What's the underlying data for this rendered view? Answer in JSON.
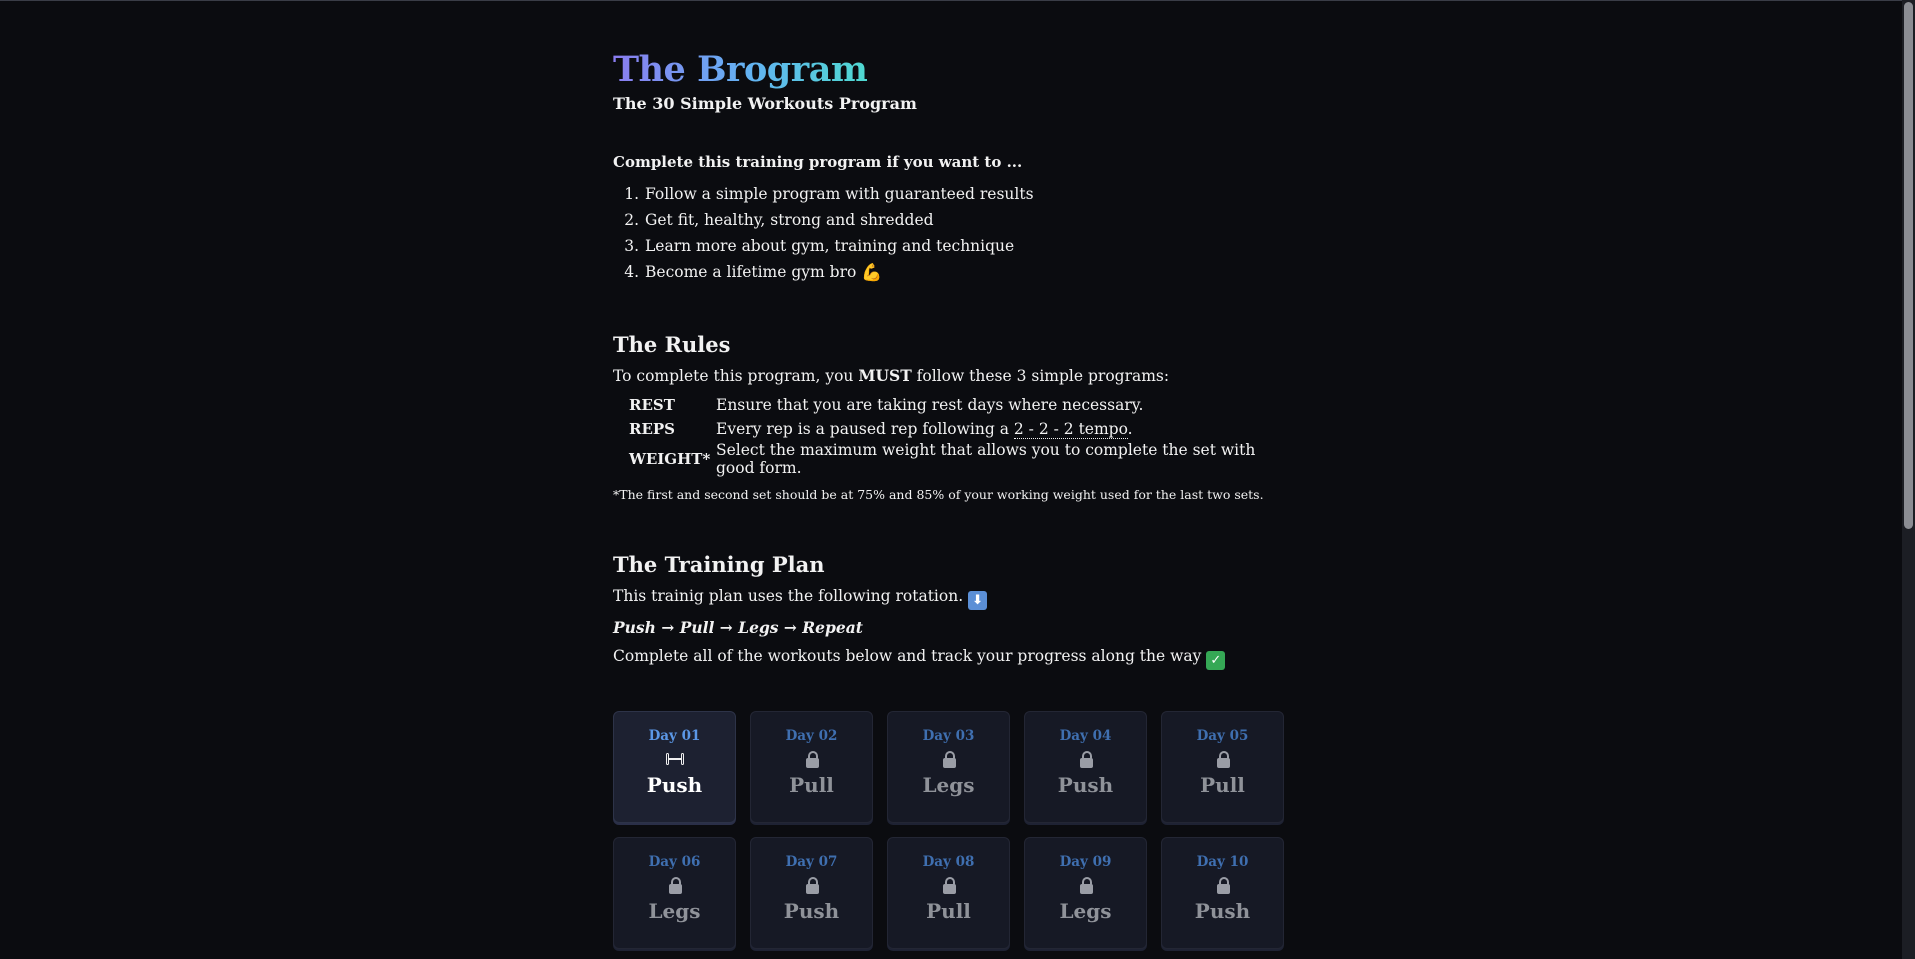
{
  "header": {
    "title": "The Brogram",
    "subtitle": "The 30 Simple Workouts Program"
  },
  "intro": {
    "lead": "Complete this training program if you want to ...",
    "goals": [
      "Follow a simple program with guaranteed results",
      "Get fit, healthy, strong and shredded",
      "Learn more about gym, training and technique",
      "Become a lifetime gym bro"
    ],
    "goal4_emoji": "flexed-biceps"
  },
  "rules": {
    "title": "The Rules",
    "lead_before": "To complete this program, you ",
    "lead_strong": "MUST",
    "lead_after": " follow these 3 simple programs:",
    "items": [
      {
        "key": "REST",
        "text": "Ensure that you are taking rest days where necessary."
      },
      {
        "key": "REPS",
        "text_before": "Every rep is a paused rep following a ",
        "tempo": "2 - 2 - 2 tempo",
        "text_after": "."
      },
      {
        "key": "WEIGHT*",
        "text": "Select the maximum weight that allows you to complete the set with good form."
      }
    ],
    "footnote": "*The first and second set should be at 75% and 85% of your working weight used for the last two sets."
  },
  "plan": {
    "title": "The Training Plan",
    "rotation_intro": "This trainig plan uses the following rotation.",
    "rotation_emoji": "down-arrow",
    "rotation": "Push → Pull → Legs → Repeat",
    "instruction": "Complete all of the workouts below and track your progress along the way",
    "instruction_emoji": "check-mark"
  },
  "days": [
    {
      "label": "Day 01",
      "name": "Push",
      "icon": "dumbbell-icon",
      "active": true
    },
    {
      "label": "Day 02",
      "name": "Pull",
      "icon": "lock-icon",
      "active": false
    },
    {
      "label": "Day 03",
      "name": "Legs",
      "icon": "lock-icon",
      "active": false
    },
    {
      "label": "Day 04",
      "name": "Push",
      "icon": "lock-icon",
      "active": false
    },
    {
      "label": "Day 05",
      "name": "Pull",
      "icon": "lock-icon",
      "active": false
    },
    {
      "label": "Day 06",
      "name": "Legs",
      "icon": "lock-icon",
      "active": false
    },
    {
      "label": "Day 07",
      "name": "Push",
      "icon": "lock-icon",
      "active": false
    },
    {
      "label": "Day 08",
      "name": "Pull",
      "icon": "lock-icon",
      "active": false
    },
    {
      "label": "Day 09",
      "name": "Legs",
      "icon": "lock-icon",
      "active": false
    },
    {
      "label": "Day 10",
      "name": "Push",
      "icon": "lock-icon",
      "active": false
    }
  ],
  "colors": {
    "background": "#0b0c10",
    "title_gradient_start": "#8a7cf0",
    "title_gradient_end": "#4fd9d1",
    "day_label": "#3f6fb0",
    "day_label_active": "#5b97e6",
    "card_bg": "#161925"
  }
}
